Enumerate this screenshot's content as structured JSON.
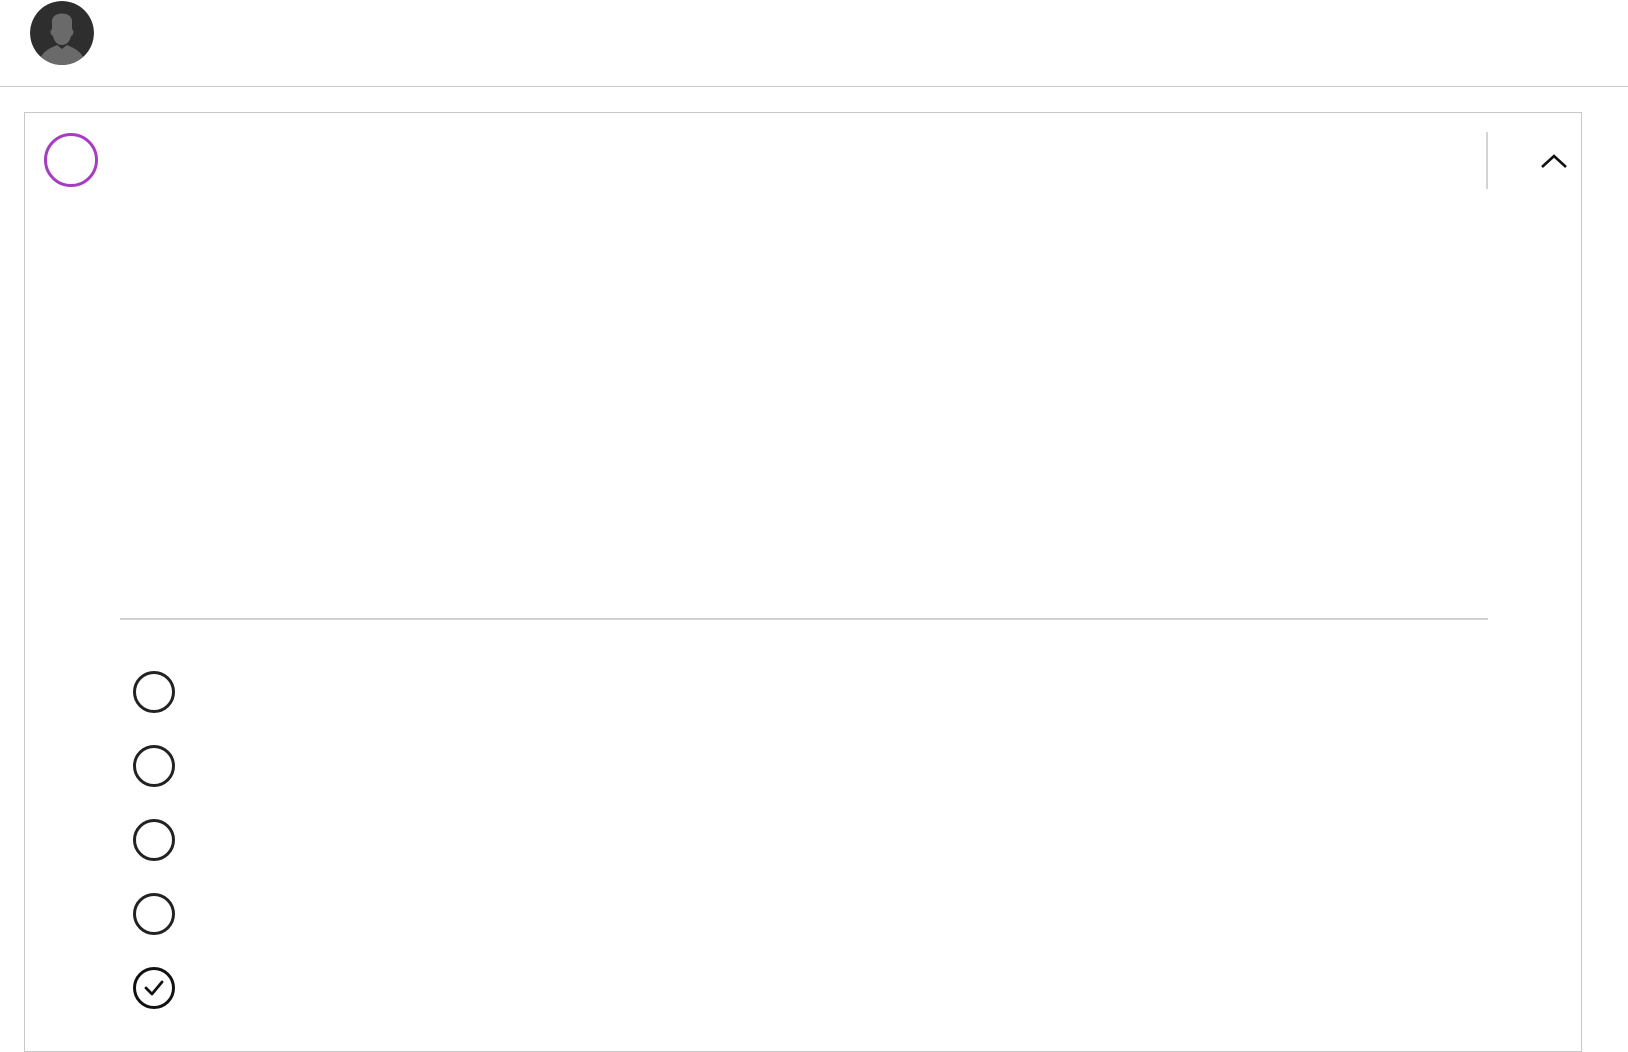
{
  "header": {
    "avatar_icon": "user-silhouette-icon"
  },
  "question_card": {
    "status_color": "#a63dc1",
    "collapse_icon": "chevron-up-icon",
    "options": [
      {
        "label": "",
        "checked": false
      },
      {
        "label": "",
        "checked": false
      },
      {
        "label": "",
        "checked": false
      },
      {
        "label": "",
        "checked": false
      },
      {
        "label": "",
        "checked": true
      }
    ]
  }
}
